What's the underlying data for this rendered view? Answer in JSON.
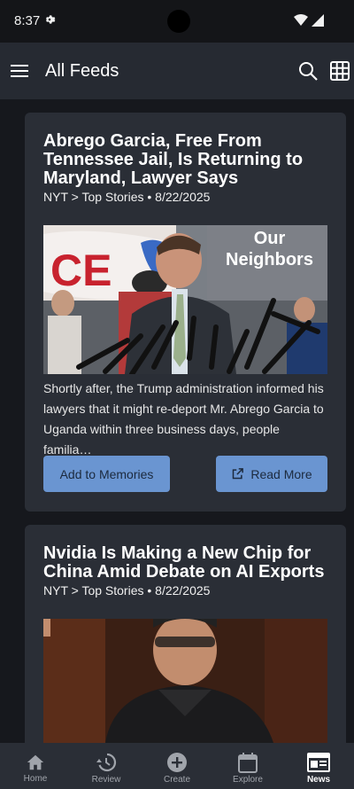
{
  "status": {
    "time": "8:37"
  },
  "header": {
    "title": "All Feeds"
  },
  "cards": [
    {
      "title": "Abrego Garcia, Free From Tennessee Jail, Is Returning to Maryland, Lawyer Says",
      "meta": "NYT > Top Stories • 8/22/2025",
      "summary": "Shortly after, the Trump administration informed his lawyers that it might re-deport Mr. Abrego Garcia to Uganda within three business days, people familia…",
      "image_text": {
        "left": "CE",
        "right": "Our Neighbors"
      },
      "add_label": "Add to Memories",
      "read_label": "Read More"
    },
    {
      "title": "Nvidia Is Making a New Chip for China Amid Debate on AI Exports",
      "meta": "NYT > Top Stories • 8/22/2025"
    }
  ],
  "nav": {
    "items": [
      {
        "label": "Home",
        "icon": "home-icon"
      },
      {
        "label": "Review",
        "icon": "history-icon"
      },
      {
        "label": "Create",
        "icon": "add-circle-icon"
      },
      {
        "label": "Explore",
        "icon": "calendar-icon"
      },
      {
        "label": "News",
        "icon": "newspaper-icon",
        "active": true
      }
    ]
  },
  "colors": {
    "background": "#16181d",
    "appbar": "#262a32",
    "card": "#2a2e36",
    "button": "#6a95d1",
    "button_text": "#1c2a3e"
  }
}
